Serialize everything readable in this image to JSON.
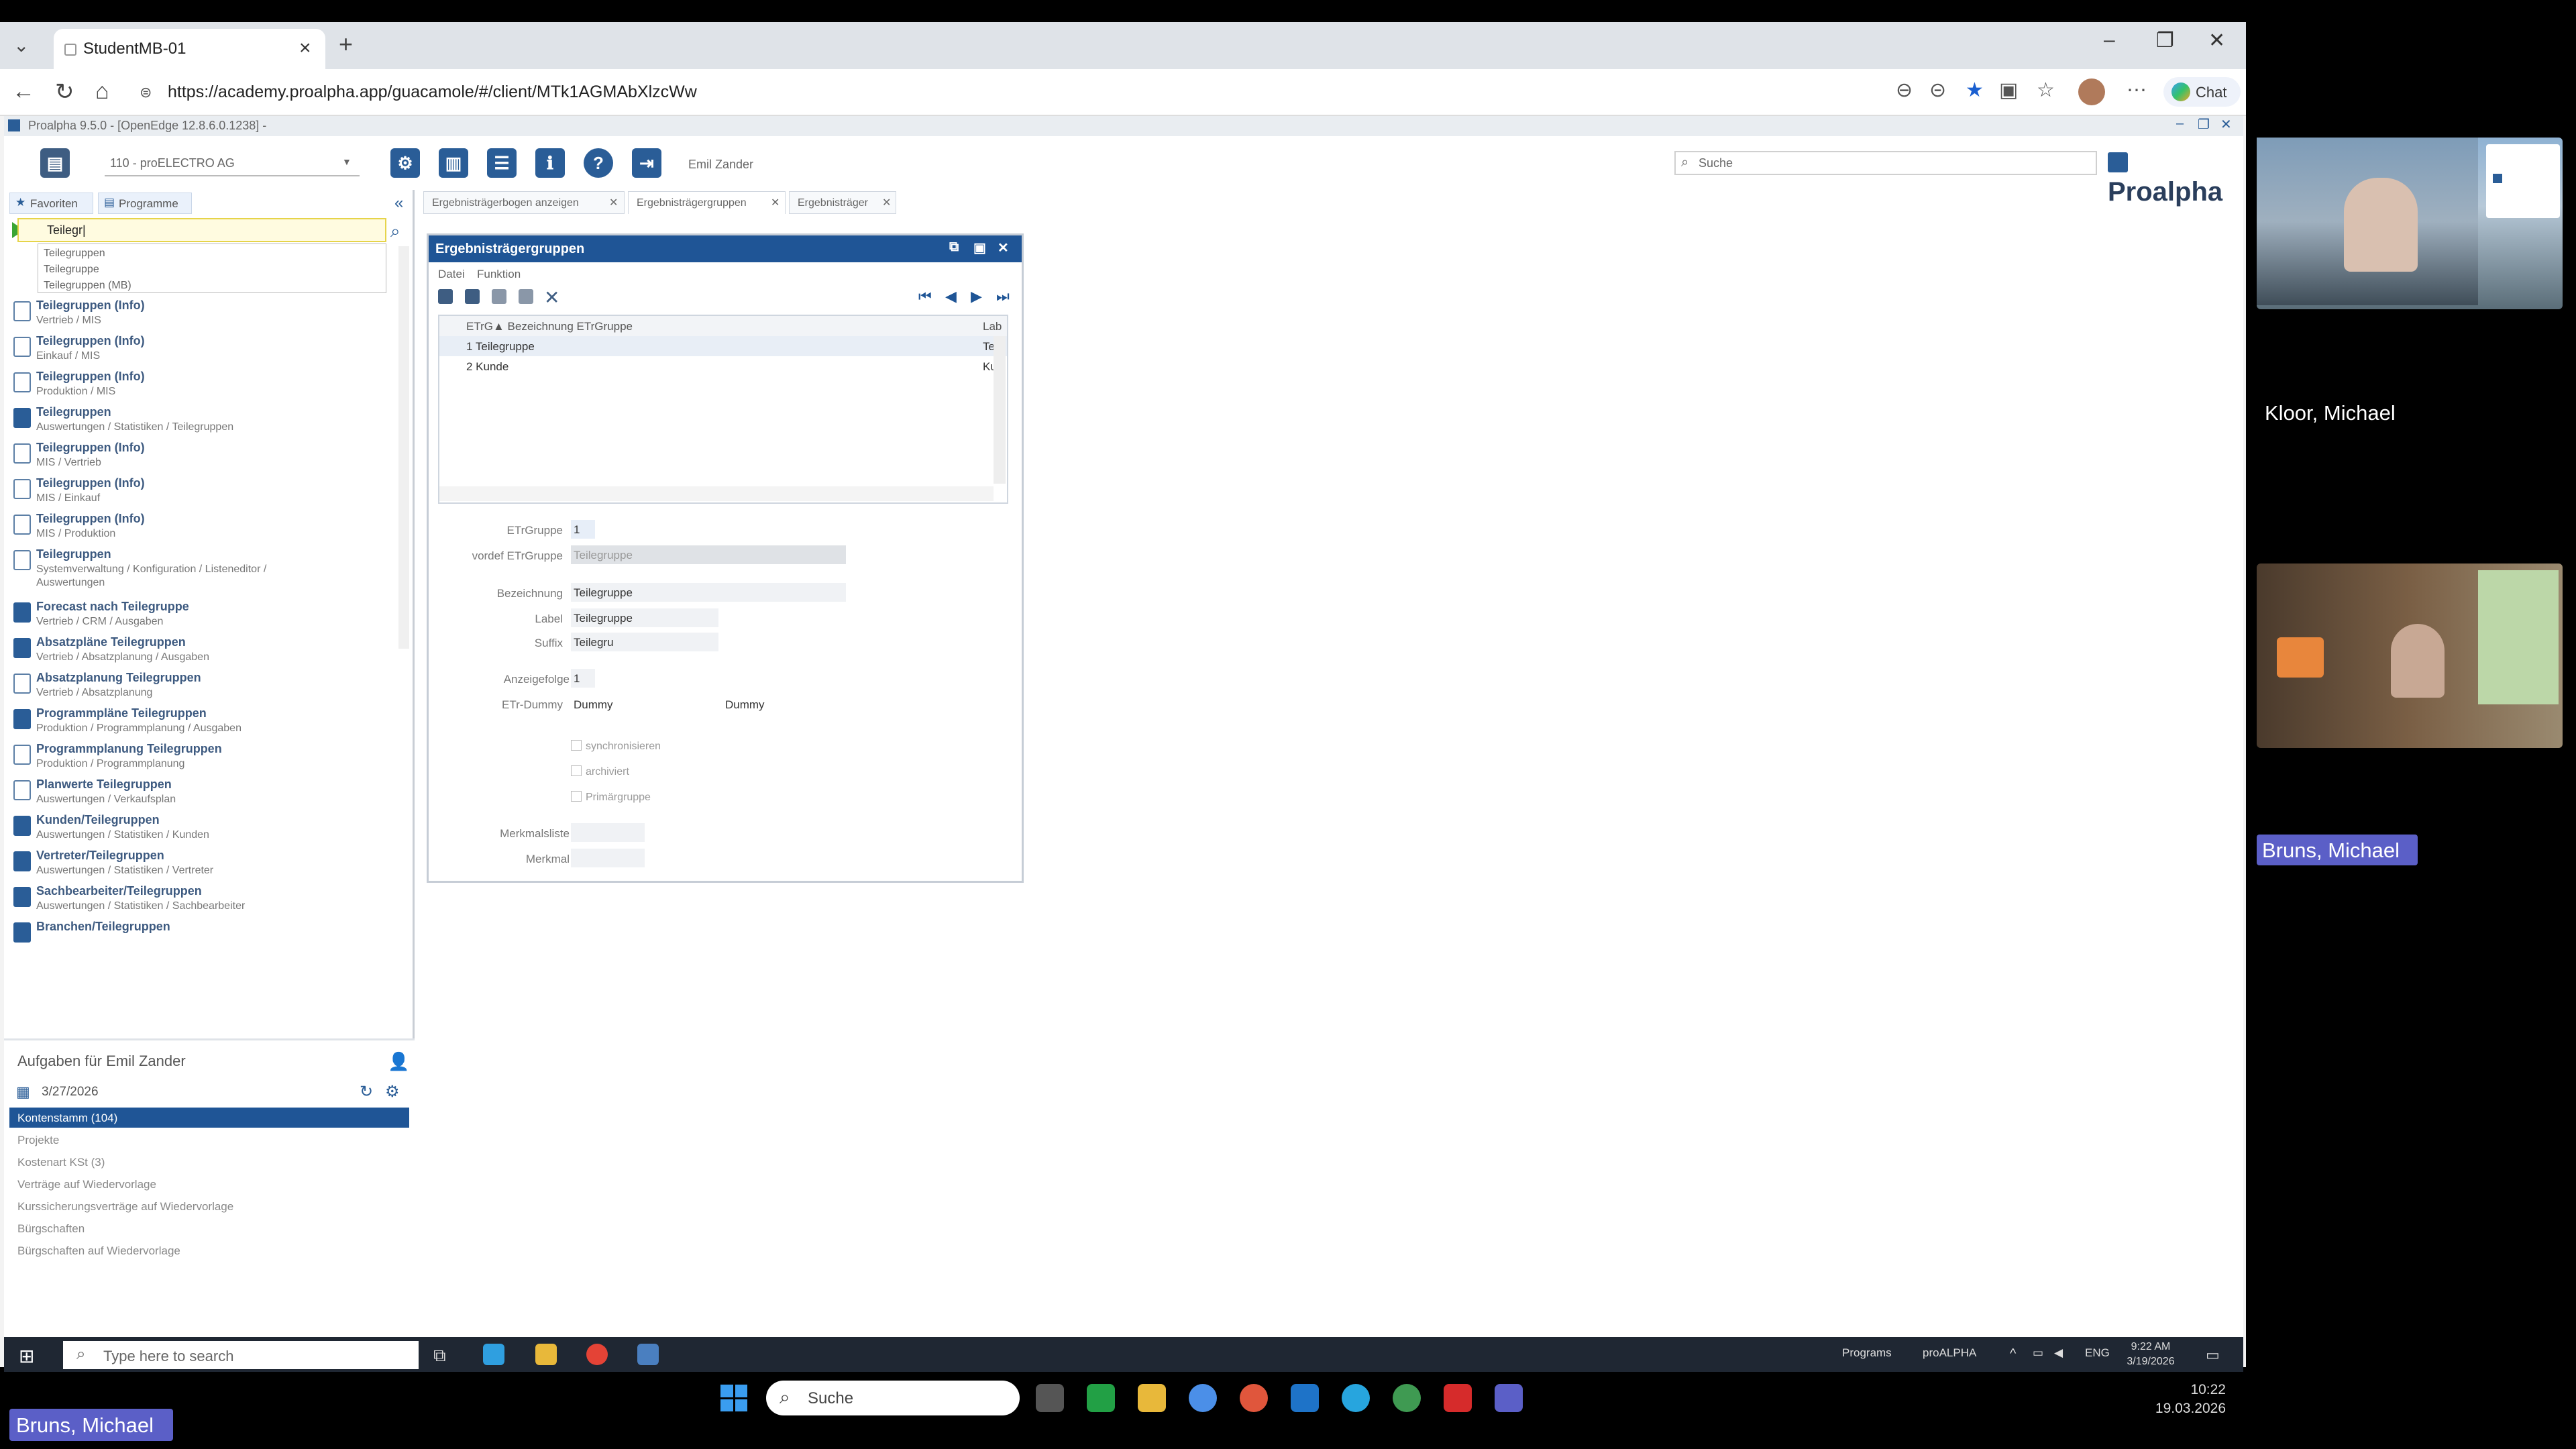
{
  "browser": {
    "tab_title": "StudentMB-01",
    "url": "https://academy.proalpha.app/guacamole/#/client/MTk1AGMAbXlzcWw",
    "chat": "Chat"
  },
  "app": {
    "title": "Proalpha 9.5.0 - [OpenEdge 12.8.6.0.1238] -",
    "company": "110 - proELECTRO AG",
    "user": "Emil Zander",
    "search_placeholder": "Suche",
    "brand": "Proalpha"
  },
  "leftpanel": {
    "tabs": [
      "Favoriten",
      "Programme"
    ],
    "search_value": "Teilegr|",
    "autocomplete": [
      "Teilegruppen",
      "Teilegruppe",
      "Teilegruppen (MB)"
    ],
    "results": [
      {
        "title": "Teilegruppen (Info)",
        "path": "Vertrieb / MIS",
        "blue": false
      },
      {
        "title": "Teilegruppen (Info)",
        "path": "Einkauf / MIS",
        "blue": false
      },
      {
        "title": "Teilegruppen (Info)",
        "path": "Produktion / MIS",
        "blue": false
      },
      {
        "title": "Teilegruppen",
        "path": "Auswertungen / Statistiken / Teilegruppen",
        "blue": true
      },
      {
        "title": "Teilegruppen (Info)",
        "path": "MIS / Vertrieb",
        "blue": false
      },
      {
        "title": "Teilegruppen (Info)",
        "path": "MIS / Einkauf",
        "blue": false
      },
      {
        "title": "Teilegruppen (Info)",
        "path": "MIS / Produktion",
        "blue": false
      },
      {
        "title": "Teilegruppen",
        "path": "Systemverwaltung / Konfiguration / Listeneditor /",
        "path2": "Auswertungen",
        "blue": false
      },
      {
        "title": "Forecast nach Teilegruppe",
        "path": "Vertrieb / CRM / Ausgaben",
        "blue": true
      },
      {
        "title": "Absatzpläne Teilegruppen",
        "path": "Vertrieb / Absatzplanung / Ausgaben",
        "blue": true
      },
      {
        "title": "Absatzplanung Teilegruppen",
        "path": "Vertrieb / Absatzplanung",
        "blue": false
      },
      {
        "title": "Programmpläne Teilegruppen",
        "path": "Produktion / Programmplanung / Ausgaben",
        "blue": true
      },
      {
        "title": "Programmplanung Teilegruppen",
        "path": "Produktion / Programmplanung",
        "blue": false
      },
      {
        "title": "Planwerte Teilegruppen",
        "path": "Auswertungen / Verkaufsplan",
        "blue": false
      },
      {
        "title": "Kunden/Teilegruppen",
        "path": "Auswertungen / Statistiken / Kunden",
        "blue": true
      },
      {
        "title": "Vertreter/Teilegruppen",
        "path": "Auswertungen / Statistiken / Vertreter",
        "blue": true
      },
      {
        "title": "Sachbearbeiter/Teilegruppen",
        "path": "Auswertungen / Statistiken / Sachbearbeiter",
        "blue": true
      },
      {
        "title": "Branchen/Teilegruppen",
        "path": "",
        "blue": true
      }
    ],
    "tasks_title": "Aufgaben für Emil Zander",
    "tasks_date": "3/27/2026",
    "tasks": [
      "Kontenstamm (104)",
      "Projekte",
      "Kostenart KSt (3)",
      "Verträge auf Wiedervorlage",
      "Kurssicherungsverträge auf Wiedervorlage",
      "Bürgschaften",
      "Bürgschaften auf Wiedervorlage"
    ]
  },
  "doctabs": [
    "Ergebnisträgerbogen anzeigen",
    "Ergebnisträgergruppen",
    "Ergebnisträger"
  ],
  "dialog": {
    "title": "Ergebnisträgergruppen",
    "menu": [
      "Datei",
      "Funktion"
    ],
    "grid_header_col1": "ETrG▲ Bezeichnung ETrGruppe",
    "grid_header_col2": "Lab",
    "rows": [
      {
        "label": "1 Teilegruppe",
        "col2": "Teil"
      },
      {
        "label": "2 Kunde",
        "col2": "Kur"
      }
    ],
    "fields": {
      "etrgruppe_label": "ETrGruppe",
      "etrgruppe": "1",
      "vordef_label": "vordef ETrGruppe",
      "vordef": "Teilegruppe",
      "bez_label": "Bezeichnung",
      "bez": "Teilegruppe",
      "label_label": "Label",
      "label": "Teilegruppe",
      "suffix_label": "Suffix",
      "suffix": "Teilegru",
      "anz_label": "Anzeigefolge",
      "anz": "1",
      "dummy_label": "ETr-Dummy",
      "dummy1": "Dummy",
      "dummy2": "Dummy",
      "cb1": "synchronisieren",
      "cb2": "archiviert",
      "cb3": "Primärgruppe",
      "merk1_label": "Merkmalsliste",
      "merk2_label": "Merkmal"
    }
  },
  "wintask": {
    "search": "Type here to search",
    "tray1": "Programs",
    "tray2": "proALPHA",
    "lang": "ENG",
    "time": "9:22 AM",
    "date": "3/19/2026"
  },
  "participants": [
    {
      "name": "Kloor, Michael"
    },
    {
      "name": "Bruns, Michael"
    }
  ],
  "outer": {
    "search": "Suche",
    "time": "10:22",
    "date": "19.03.2026",
    "self": "Bruns, Michael"
  }
}
